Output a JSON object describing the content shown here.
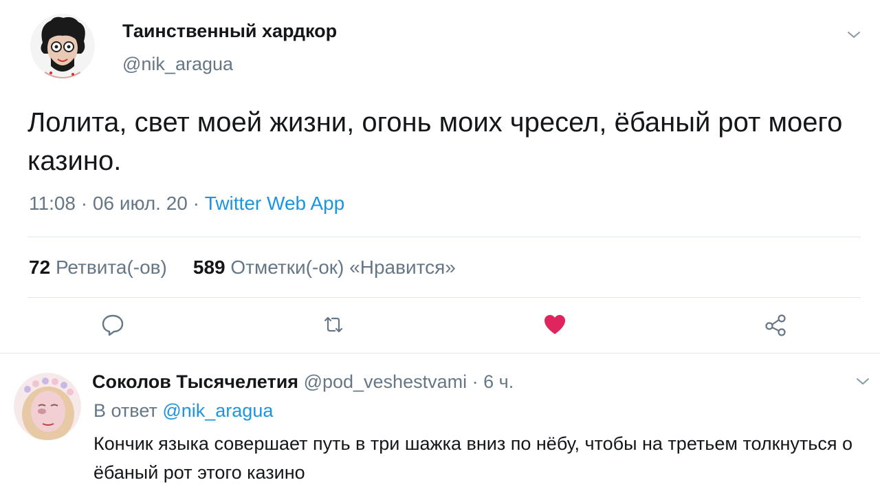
{
  "tweet": {
    "author_name": "Таинственный хардкор",
    "author_handle": "@nik_aragua",
    "text": "Лолита, свет моей жизни, огонь моих чресел, ёбаный рот моего казино.",
    "time": "11:08",
    "date": "06 июл. 20",
    "source": "Twitter Web App",
    "separator": "·",
    "retweets_count": "72",
    "retweets_label": "Ретвита(-ов)",
    "likes_count": "589",
    "likes_label": "Отметки(-ок) «Нравится»",
    "liked": true
  },
  "actions": {
    "reply": "reply-icon",
    "retweet": "retweet-icon",
    "like": "heart-icon",
    "share": "share-icon"
  },
  "reply": {
    "author_name": "Соколов Тысячелетия",
    "author_handle": "@pod_veshestvami",
    "separator": "·",
    "time_ago": "6 ч.",
    "in_reply_prefix": "В ответ",
    "in_reply_handle": "@nik_aragua",
    "text": "Кончик языка совершает путь в три шажка вниз по нёбу, чтобы на третьем толкнуться о ёбаный рот этого казино"
  },
  "colors": {
    "accent": "#1b95e0",
    "like": "#e0245e",
    "secondary_text": "#657786",
    "primary_text": "#14171a",
    "divider": "#e1e8ed"
  }
}
